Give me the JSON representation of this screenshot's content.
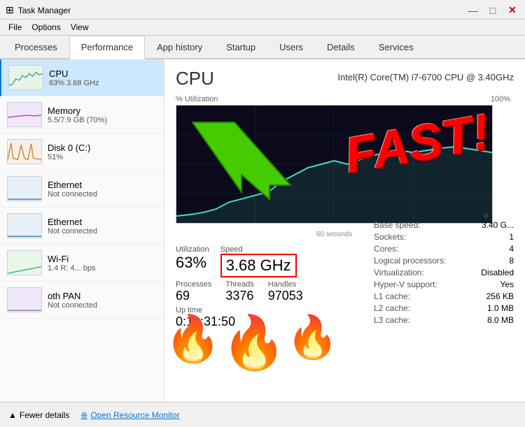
{
  "titleBar": {
    "icon": "⊞",
    "title": "Task Manager",
    "minimize": "—",
    "maximize": "□",
    "close": "✕"
  },
  "menuBar": {
    "items": [
      "File",
      "Options",
      "View"
    ]
  },
  "tabs": [
    {
      "label": "Processes",
      "active": false
    },
    {
      "label": "Performance",
      "active": true
    },
    {
      "label": "App history",
      "active": false
    },
    {
      "label": "Startup",
      "active": false
    },
    {
      "label": "Users",
      "active": false
    },
    {
      "label": "Details",
      "active": false
    },
    {
      "label": "Services",
      "active": false
    }
  ],
  "leftPanel": {
    "devices": [
      {
        "name": "CPU",
        "stats": "63%  3.68 GHz",
        "active": true
      },
      {
        "name": "Memory",
        "stats": "5.5/7.9 GB (70%)",
        "active": false
      },
      {
        "name": "Disk 0 (C:)",
        "stats": "51%",
        "active": false
      },
      {
        "name": "Ethernet",
        "stats": "Not connected",
        "active": false
      },
      {
        "name": "Ethernet",
        "stats": "Not connected",
        "active": false
      },
      {
        "name": "Wi-Fi",
        "stats": "1.4 R: 4... bps",
        "active": false
      },
      {
        "name": "oth PAN",
        "stats": "Not connected",
        "active": false
      }
    ]
  },
  "rightPanel": {
    "cpuTitle": "CPU",
    "cpuModel": "Intel(R) Core(TM) i7-6700 CPU @ 3.40GHz",
    "graphLabel": "% Utilization",
    "graphLabelRight": "100%",
    "graphLabelZero": "0",
    "graphTimestamp": "60 seconds",
    "utilization": {
      "label": "Utilization",
      "value": "63%"
    },
    "speed": {
      "label": "Speed",
      "value": "3.68 GHz"
    },
    "processes": {
      "label": "Processes",
      "value": "69"
    },
    "threads": {
      "label": "Threads",
      "value": "3376"
    },
    "handles": {
      "label": "Handles",
      "value": "97053"
    },
    "uptime": {
      "label": "Up time",
      "value": "0:10:31:50"
    },
    "fastText": "FAST!",
    "specs": [
      {
        "key": "Base speed:",
        "val": "3.40 G..."
      },
      {
        "key": "Sockets:",
        "val": "1"
      },
      {
        "key": "Cores:",
        "val": "4"
      },
      {
        "key": "Logical processors:",
        "val": "8"
      },
      {
        "key": "Virtualization:",
        "val": "Disabled"
      },
      {
        "key": "Hyper-V support:",
        "val": "Yes"
      },
      {
        "key": "L1 cache:",
        "val": "256 KB"
      },
      {
        "key": "L2 cache:",
        "val": "1.0 MB"
      },
      {
        "key": "L3 cache:",
        "val": "8.0 MB"
      }
    ]
  },
  "bottomBar": {
    "fewerDetails": "Fewer details",
    "openMonitor": "Open Resource Monitor"
  }
}
